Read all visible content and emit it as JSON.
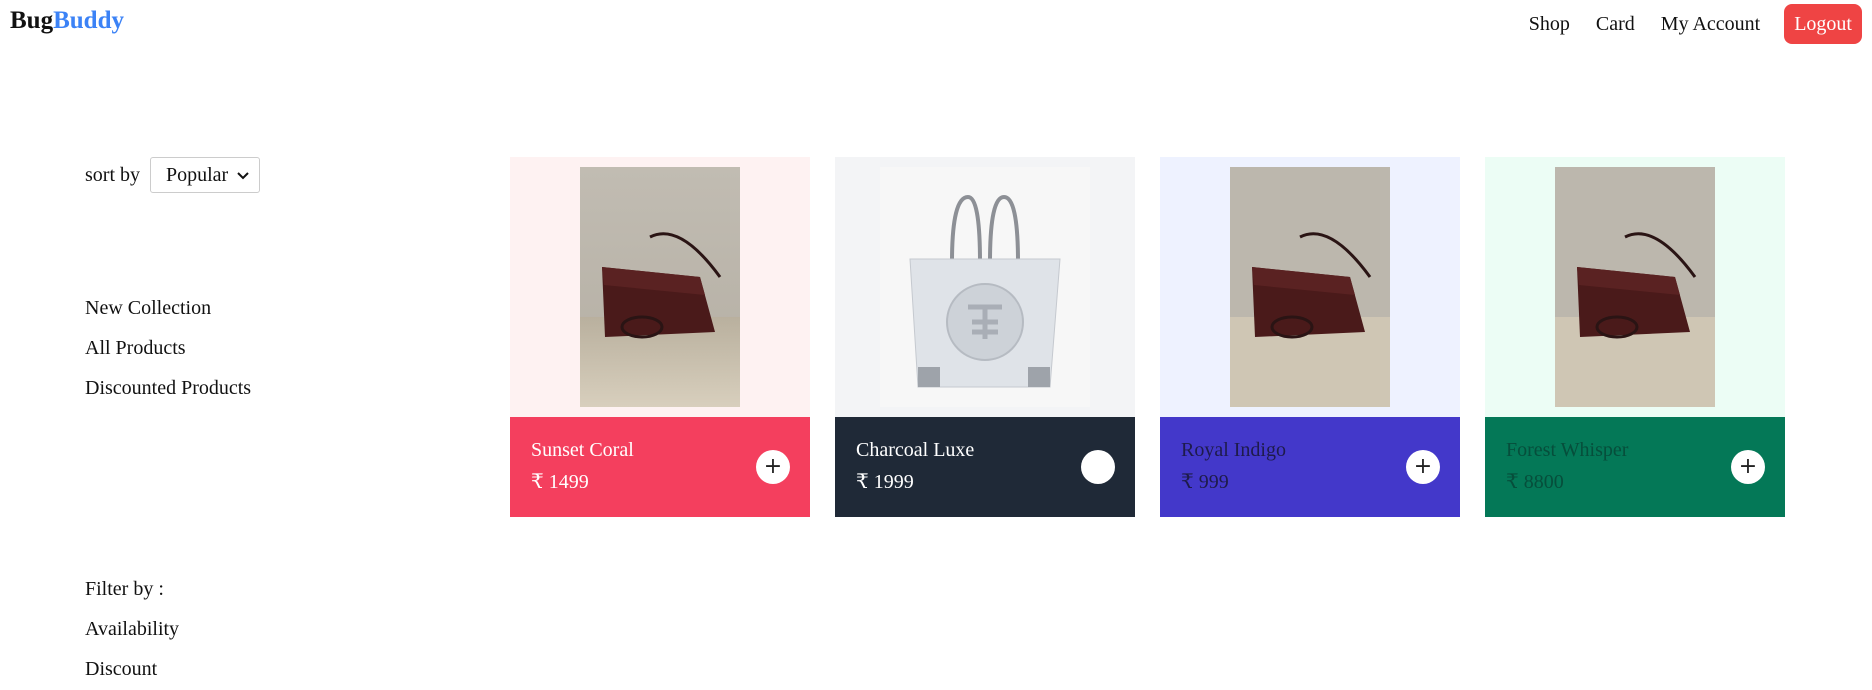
{
  "header": {
    "logo_part1": "Bug",
    "logo_part2": "Buddy",
    "nav": {
      "shop": "Shop",
      "card": "Card",
      "account": "My Account",
      "logout": "Logout"
    }
  },
  "sidebar": {
    "sort_label": "sort by",
    "sort_value": "Popular",
    "menu": [
      "New Collection",
      "All Products",
      "Discounted Products"
    ],
    "filter_label": "Filter by :",
    "filters": [
      "Availability",
      "Discount"
    ]
  },
  "products": [
    {
      "name": "Sunset Coral",
      "price": "₹ 1499",
      "bg": "#fef2f2",
      "panel": "#f43f5e",
      "text": "#ffffff",
      "image": "brown-handbag",
      "add": "+"
    },
    {
      "name": "Charcoal Luxe",
      "price": "₹ 1999",
      "bg": "#f3f4f6",
      "panel": "#1f2937",
      "text": "#ffffff",
      "image": "white-tote-bag",
      "add": ""
    },
    {
      "name": "Royal Indigo",
      "price": "₹ 999",
      "bg": "#eef2ff",
      "panel": "#4338ca",
      "text": "#1e1b4b",
      "image": "brown-handbag",
      "add": "+"
    },
    {
      "name": "Forest Whisper",
      "price": "₹ 8800",
      "bg": "#ecfdf5",
      "panel": "#047857",
      "text": "#064e3b",
      "image": "brown-handbag",
      "add": "+"
    }
  ],
  "colors": {
    "accent": "#3b82f6",
    "logout": "#ef4444"
  }
}
